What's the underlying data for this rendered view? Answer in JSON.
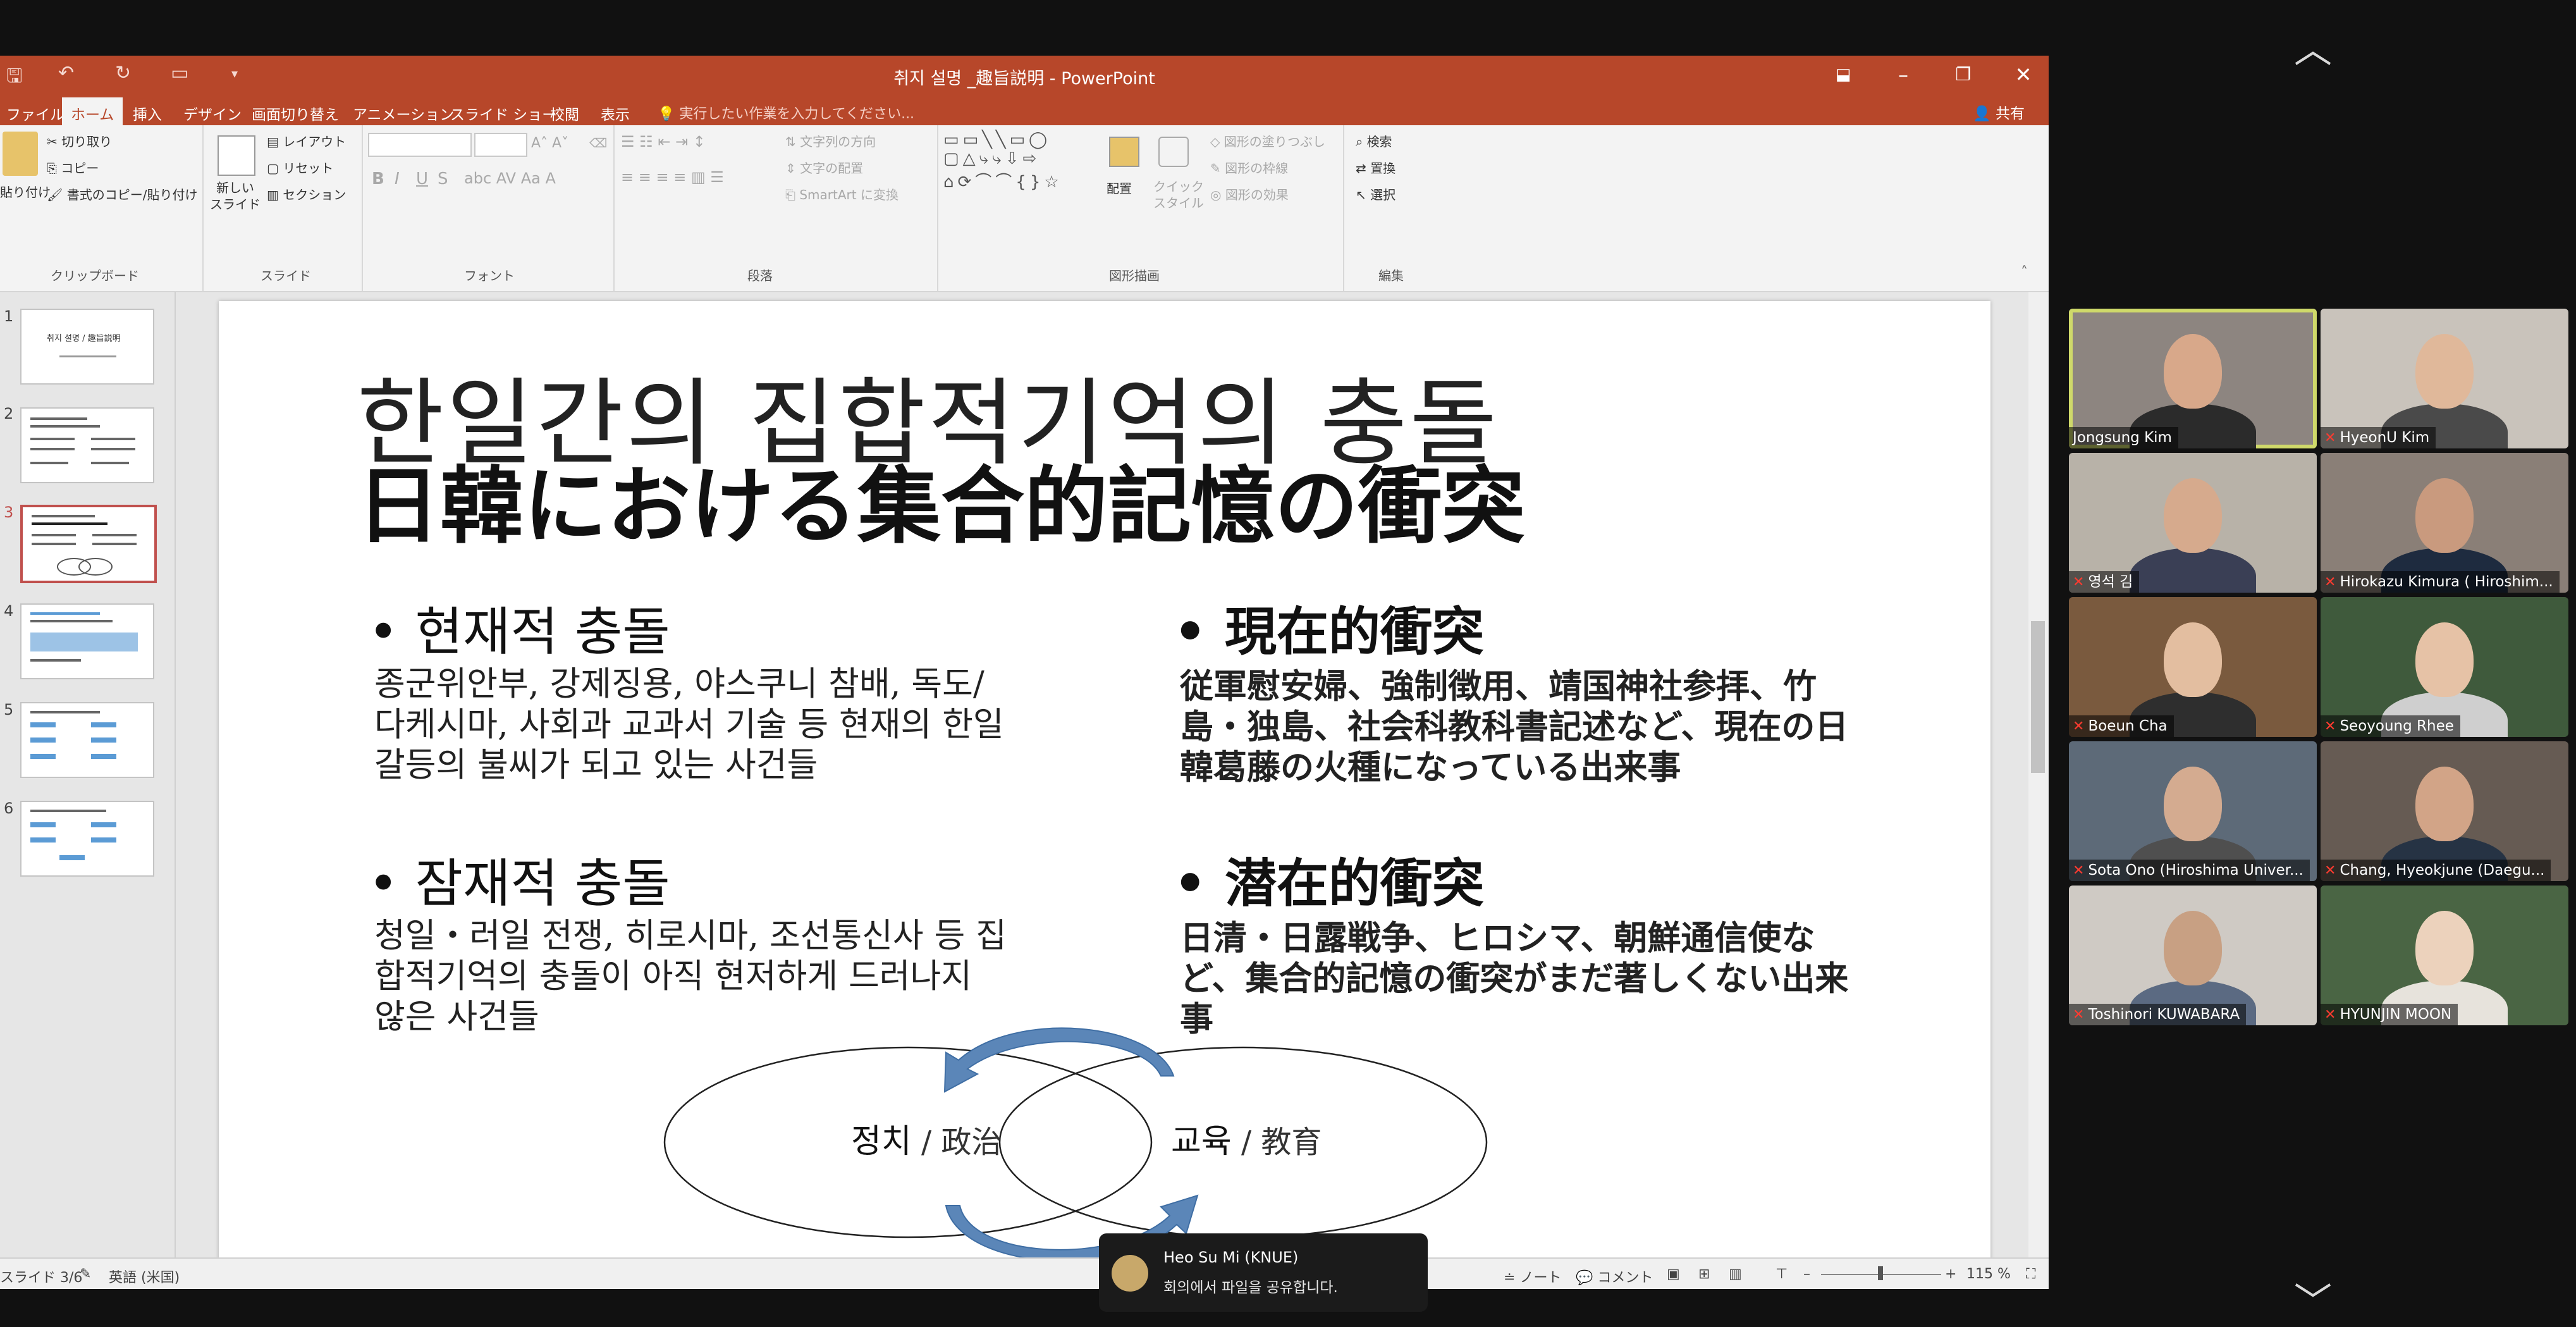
{
  "window": {
    "title": "취지 설명 _趣旨説明 - PowerPoint",
    "share_label": "共有",
    "tell_me_placeholder": "実行したい作業を入力してください..."
  },
  "ribbon_tabs": [
    "ファイル",
    "ホーム",
    "挿入",
    "デザイン",
    "画面切り替え",
    "アニメーション",
    "スライド ショー",
    "校閲",
    "表示"
  ],
  "ribbon": {
    "clipboard": {
      "paste": "貼り付け",
      "cut": "切り取り",
      "copy": "コピー",
      "format_painter": "書式のコピー/貼り付け",
      "label": "クリップボード"
    },
    "slides": {
      "new_slide": "新しい\nスライド",
      "layout": "レイアウト",
      "reset": "リセット",
      "section": "セクション",
      "label": "スライド"
    },
    "font": {
      "bold": "B",
      "italic": "I",
      "underline": "U",
      "strike": "S",
      "label": "フォント"
    },
    "paragraph": {
      "text_direction": "文字列の方向",
      "align_text": "文字の配置",
      "smartart": "SmartArt に変換",
      "label": "段落"
    },
    "drawing": {
      "arrange": "配置",
      "quick_styles": "クイック\nスタイル",
      "fill": "図形の塗りつぶし",
      "outline": "図形の枠線",
      "effects": "図形の効果",
      "label": "図形描画"
    },
    "editing": {
      "find": "検索",
      "replace": "置換",
      "select": "選択",
      "label": "編集"
    }
  },
  "thumbnails": {
    "numbers": [
      "1",
      "2",
      "3",
      "4",
      "5",
      "6"
    ],
    "selected_index": 3,
    "titles": [
      "취지 설명 / 趣旨説明"
    ]
  },
  "slide": {
    "title_ko": "한일간의 집합적기억의 충돌",
    "title_ja": "日韓における集合的記憶の衝突",
    "left": {
      "h1": "현재적 충돌",
      "p1": "종군위안부, 강제징용, 야스쿠니 참배, 독도/다케시마, 사회과 교과서 기술 등 현재의 한일갈등의 불씨가 되고 있는 사건들",
      "h2": "잠재적 충돌",
      "p2": "청일・러일 전쟁, 히로시마, 조선통신사 등 집합적기억의 충돌이 아직 현저하게 드러나지 않은 사건들"
    },
    "right": {
      "h1": "現在的衝突",
      "p1": "従軍慰安婦、強制徴用、靖国神社参拝、竹島・独島、社会科教科書記述など、現在の日韓葛藤の火種になっている出来事",
      "h2": "潜在的衝突",
      "p2": "日清・日露戦争、ヒロシマ、朝鮮通信使など、集合的記憶の衝突がまだ著しくない出来事"
    },
    "venn": {
      "left_ko": "정치",
      "left_sep": " / ",
      "left_ja": "政治",
      "right_ko": "교육",
      "right_sep": " / ",
      "right_ja": "教育",
      "arrow_color": "#5b86b8"
    }
  },
  "statusbar": {
    "slide_counter": "スライド 3/6",
    "language": "英語 (米国)",
    "notes": "ノート",
    "comments": "コメント",
    "zoom": "115 %"
  },
  "zoom_participants": [
    {
      "name": "Jongsung Kim",
      "muted": false,
      "active": true
    },
    {
      "name": "HyeonU Kim",
      "muted": true,
      "active": false
    },
    {
      "name": "영석 김",
      "muted": true,
      "active": false
    },
    {
      "name": "Hirokazu Kimura ( Hiroshim...",
      "muted": true,
      "active": false
    },
    {
      "name": "Boeun Cha",
      "muted": true,
      "active": false
    },
    {
      "name": "Seoyoung Rhee",
      "muted": true,
      "active": false
    },
    {
      "name": "Sota Ono (Hiroshima Univer...",
      "muted": true,
      "active": false
    },
    {
      "name": "Chang, Hyeokjune (Daegu...",
      "muted": true,
      "active": false
    },
    {
      "name": "Toshinori KUWABARA",
      "muted": true,
      "active": false
    },
    {
      "name": "HYUNJIN MOON",
      "muted": true,
      "active": false
    }
  ],
  "notification": {
    "name": "Heo Su Mi (KNUE)",
    "message": "회의에서 파일을 공유합니다."
  },
  "colors": {
    "powerpoint_accent": "#b7472a",
    "active_speaker_border": "#cfd96a",
    "muted_icon": "#ff3b30"
  }
}
